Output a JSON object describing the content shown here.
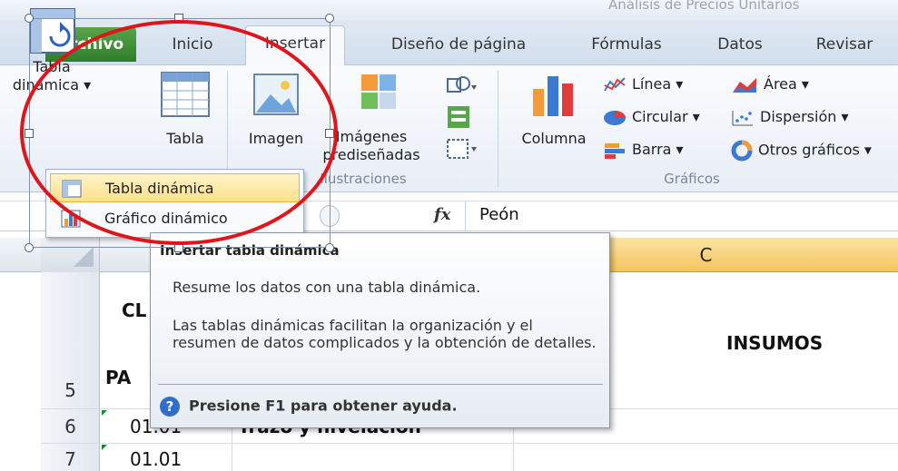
{
  "window": {
    "title": "Análisis de Precios Unitarios"
  },
  "tabs": {
    "archivo": "Archivo",
    "inicio": "Inicio",
    "insertar": "Insertar",
    "diseno": "Diseño de página",
    "formulas": "Fórmulas",
    "datos": "Datos",
    "revisar": "Revisar"
  },
  "ribbon": {
    "tabla_dinamica": "Tabla dinámica ▾",
    "tabla": "Tabla",
    "imagen": "Imagen",
    "imagenes_prediseñadas": "Imágenes prediseñadas",
    "columna": "Columna",
    "linea": "Línea ▾",
    "area": "Área ▾",
    "circular": "Circular ▾",
    "dispersion": "Dispersión ▾",
    "barra": "Barra ▾",
    "otros": "Otros gráficos ▾",
    "group_ilustraciones": "Ilustraciones",
    "group_graficos": "Gráficos"
  },
  "dropdown": {
    "item1": "Tabla dinámica",
    "item2": "Gráfico dinámico"
  },
  "formula_bar": {
    "fx": "fx",
    "value": "Peón"
  },
  "grid": {
    "col_c": "C",
    "rows": [
      "5",
      "6",
      "7"
    ],
    "cell_cl": "CL",
    "cell_pa": "PA",
    "cell_insumos": "INSUMOS",
    "cell_6_b": "01.01",
    "cell_6_c": "Trazo y nivelación",
    "cell_7_b": "01.01"
  },
  "tooltip": {
    "title": "Insertar tabla dinámica",
    "text1": "Resume los datos con una tabla dinámica.",
    "text2": "Las tablas dinámicas facilitan la organización y el resumen de datos complicados y la obtención de detalles.",
    "help": "Presione F1 para obtener ayuda."
  },
  "colors": {
    "accent_green": "#2f7d2a",
    "highlight_orange": "#f5c45a",
    "annotation_red": "#e0141b"
  }
}
